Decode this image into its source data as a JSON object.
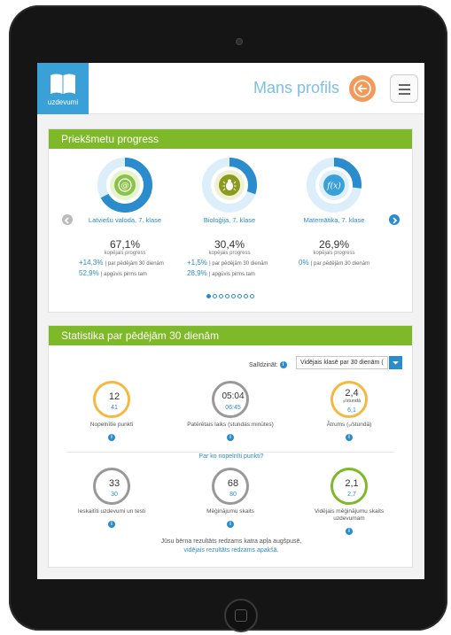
{
  "header": {
    "logo_text": "uzdevumi",
    "title": "Mans profils"
  },
  "progress": {
    "title": "Priekšmetu progress",
    "subjects": [
      {
        "name": "Latviešu valoda, 7. klase",
        "icon": "at-icon",
        "percent": "67,1%",
        "overall_label": "kopējais progress",
        "delta_30": "+14,3%",
        "delta_30_label": "par pēdējām 30 dienām",
        "prior": "52,9%",
        "prior_label": "apgūvis pirms tam",
        "progress_value": 0.671,
        "colors": {
          "ring": "#2a8ccc",
          "ring2": "#1fb2a6",
          "badge": "#8bc34a"
        }
      },
      {
        "name": "Bioloģija, 7. klase",
        "icon": "bug-icon",
        "percent": "30,4%",
        "overall_label": "kopējais progress",
        "delta_30": "+1,5%",
        "delta_30_label": "par pēdējām 30 dienām",
        "prior": "28,9%",
        "prior_label": "apgūvis pirms tam",
        "progress_value": 0.304,
        "colors": {
          "ring": "#2a8ccc",
          "badge": "#8a9b1c"
        }
      },
      {
        "name": "Matemātika, 7. klase",
        "icon": "function-icon",
        "percent": "26,9%",
        "overall_label": "kopējais progress",
        "delta_30": "0%",
        "delta_30_label": "par pēdējām 30 dienām",
        "progress_value": 0.269,
        "colors": {
          "ring": "#2a8ccc",
          "badge": "#3aa0d8"
        }
      }
    ],
    "page_count": 8,
    "active_page": 1
  },
  "stats": {
    "title": "Statistika par pēdējām 30 dienām",
    "compare_label": "Salīdzināt:",
    "compare_value": "Vidējais klasē par 30 dienām (",
    "why_link": "Par ko nopelnīti punkti?",
    "items": [
      {
        "main": "12",
        "sub": "41",
        "label": "Nopelnītie punkti",
        "color": "#f5b942"
      },
      {
        "main": "05:04",
        "sub": "06:45",
        "label": "Patērētais laiks (stundas:minūtes)",
        "color": "#999999"
      },
      {
        "main": "2,4",
        "unit": "₉/stundā",
        "sub": "6,1",
        "label": "Ātrums (₉/stundā)",
        "color": "#f5b942"
      },
      {
        "main": "33",
        "sub": "30",
        "label": "Ieskaitīti uzdevumi un testi",
        "color": "#999999"
      },
      {
        "main": "68",
        "sub": "80",
        "label": "Mēģinājumu skaits",
        "color": "#999999"
      },
      {
        "main": "2,1",
        "sub": "2,7",
        "label": "Vidējais mēģinājumu skaits uzdevumam",
        "color": "#7db928"
      }
    ],
    "note_line1": "Jūsu bērna rezultāts redzams katra apļa augšpusē,",
    "note_line2": "vidējais rezultāts redzams apakšā."
  },
  "colors": {
    "accent_blue": "#2a8ccc",
    "header_green": "#7db928",
    "logo_blue": "#3aa0d8",
    "back_orange": "#f39a5a"
  }
}
